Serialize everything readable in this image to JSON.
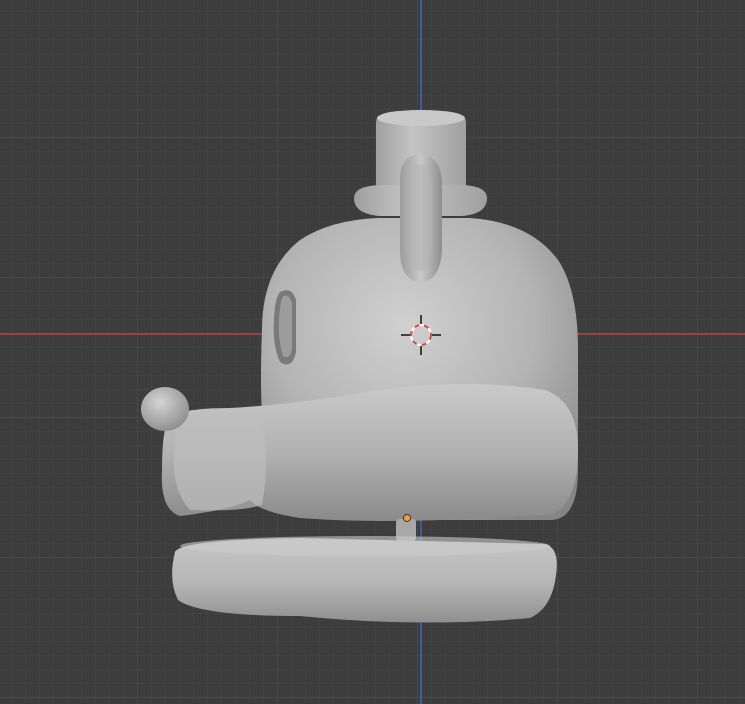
{
  "viewport": {
    "background_color": "#3d3d3d",
    "grid_minor_color": "#474747",
    "grid_major_color": "#525252",
    "x_axis_color": "#b3424a",
    "z_axis_color": "#3a68c2",
    "view": "front-orthographic",
    "grid": true
  },
  "model": {
    "description_name": "cartoon-character-head",
    "material_color": "#b9b9b9",
    "shading": "solid"
  },
  "cursor_3d": {
    "ring_colors": [
      "#ffffff",
      "#e0453a"
    ]
  },
  "origin_point": {
    "color": "#f0a030"
  }
}
